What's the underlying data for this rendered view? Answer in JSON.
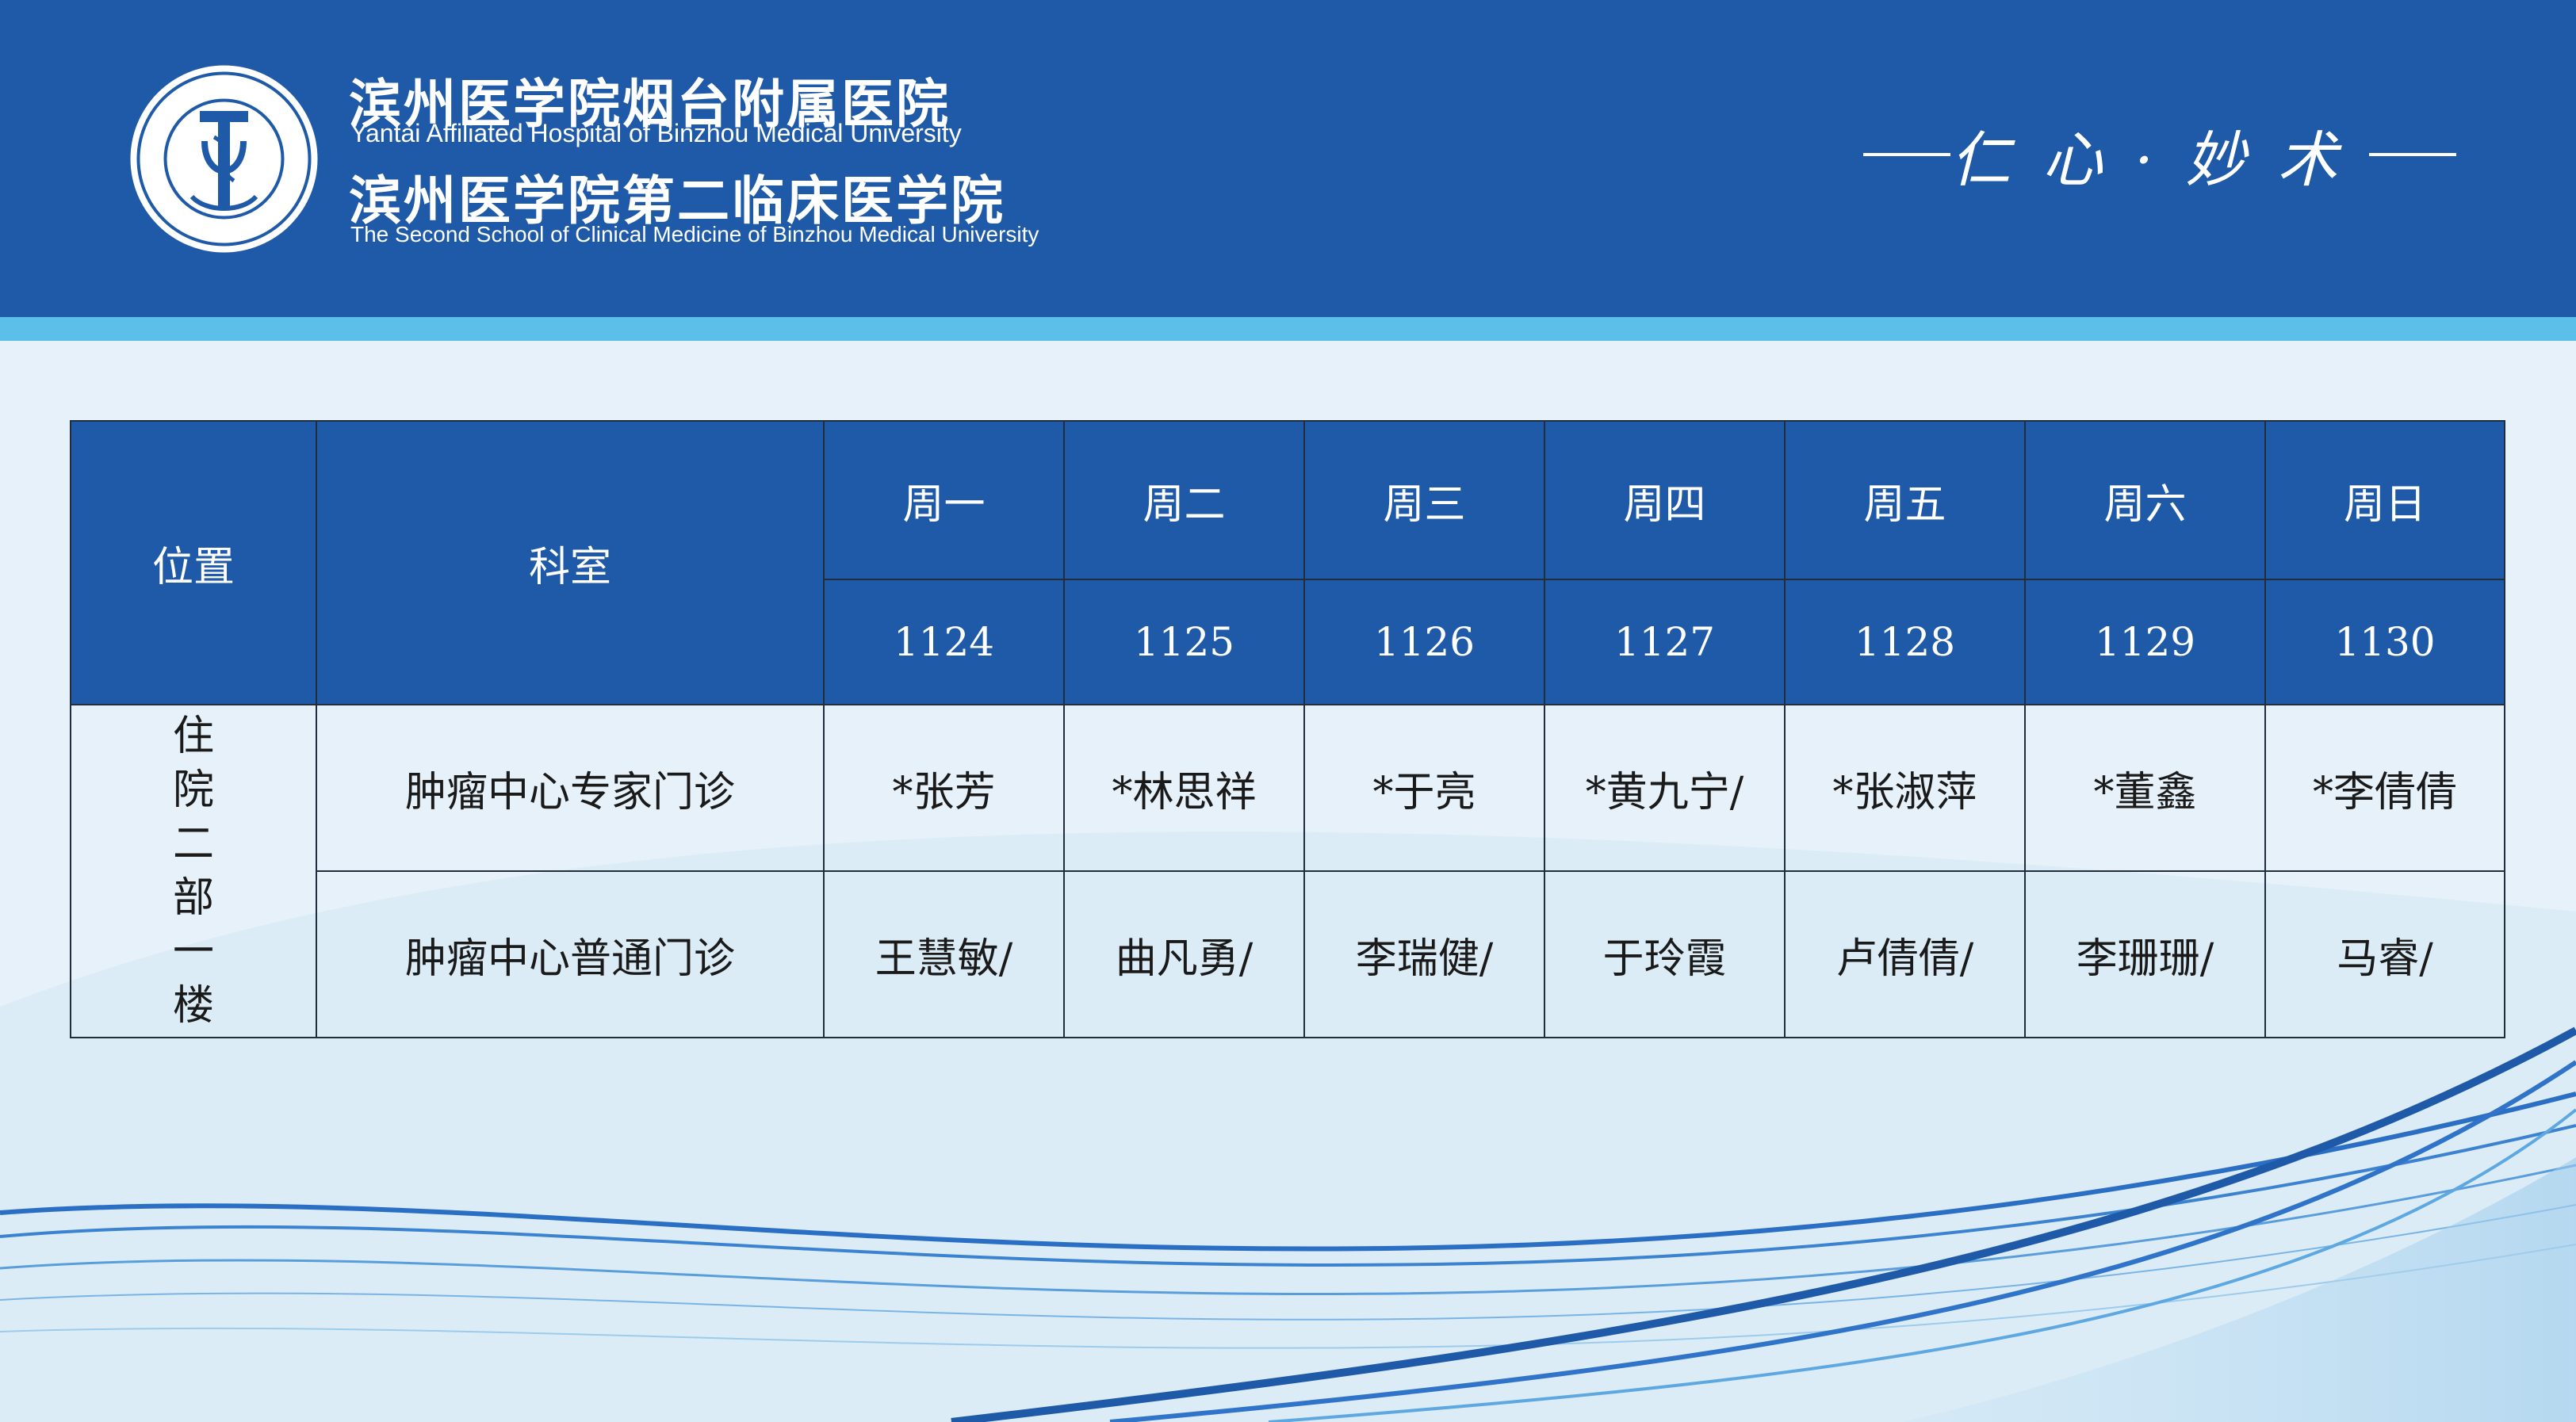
{
  "header": {
    "title_cn_1": "滨州医学院烟台附属医院",
    "title_en_1": "Yantai Affiliated Hospital of Binzhou Medical University",
    "title_cn_2": "滨州医学院第二临床医学院",
    "title_en_2": "The Second School of Clinical Medicine of Binzhou Medical University",
    "logo_ring_text": "滨州医学院烟台附属医院 · Yantai Affiliated Hospital of Binzhou Medical University",
    "motto": "仁心·妙术",
    "colors": {
      "header_blue": "#1e5aa8",
      "stripe_cyan": "#5cbfe9",
      "background": "#e6f1f9"
    }
  },
  "table": {
    "col_location": "位置",
    "col_department": "科室",
    "days": [
      "周一",
      "周二",
      "周三",
      "周四",
      "周五",
      "周六",
      "周日"
    ],
    "dates": [
      "1124",
      "1125",
      "1126",
      "1127",
      "1128",
      "1129",
      "1130"
    ],
    "location": "住院二部一楼",
    "rows": [
      {
        "department": "肿瘤中心专家门诊",
        "cells": [
          "*张芳",
          "*林思祥",
          "*于亮",
          "*黄九宁/",
          "*张淑萍",
          "*董鑫",
          "*李倩倩"
        ]
      },
      {
        "department": "肿瘤中心普通门诊",
        "cells": [
          "王慧敏/",
          "曲凡勇/",
          "李瑞健/",
          "于玲霞",
          "卢倩倩/",
          "李珊珊/",
          "马睿/"
        ]
      }
    ]
  }
}
